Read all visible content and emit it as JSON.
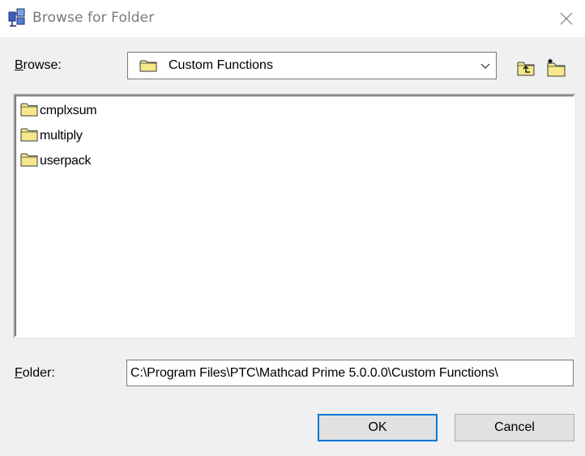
{
  "window": {
    "title": "Browse for Folder"
  },
  "browse": {
    "label_accel": "B",
    "label_rest": "rowse:",
    "current_folder": "Custom Functions"
  },
  "folders": [
    {
      "name": "cmplxsum"
    },
    {
      "name": "multiply"
    },
    {
      "name": "userpack"
    }
  ],
  "folder_field": {
    "label_accel": "F",
    "label_rest": "older:",
    "value": "C:\\Program Files\\PTC\\Mathcad Prime 5.0.0.0\\Custom Functions\\"
  },
  "buttons": {
    "ok": "OK",
    "cancel": "Cancel"
  },
  "colors": {
    "folder_yellow": "#f5e88a",
    "accent_blue": "#0078d7"
  }
}
